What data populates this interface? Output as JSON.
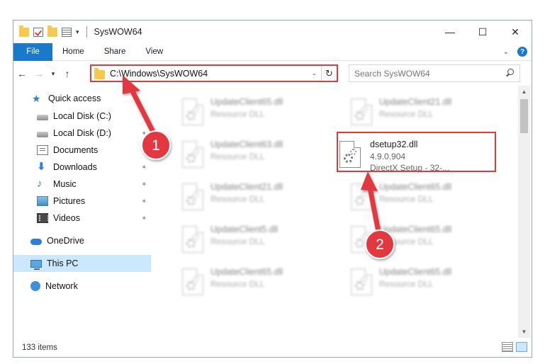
{
  "window": {
    "title": "SysWOW64"
  },
  "ribbon": {
    "tabs": [
      "File",
      "Home",
      "Share",
      "View"
    ]
  },
  "address": {
    "path": "C:\\Windows\\SysWOW64"
  },
  "search": {
    "placeholder": "Search SysWOW64"
  },
  "sidebar": {
    "items": [
      {
        "label": "Quick access",
        "icon": "star-icon"
      },
      {
        "label": "Local Disk (C:)",
        "icon": "drive-icon"
      },
      {
        "label": "Local Disk (D:)",
        "icon": "drive-icon"
      },
      {
        "label": "Documents",
        "icon": "documents-icon"
      },
      {
        "label": "Downloads",
        "icon": "downloads-icon"
      },
      {
        "label": "Music",
        "icon": "music-icon"
      },
      {
        "label": "Pictures",
        "icon": "pictures-icon"
      },
      {
        "label": "Videos",
        "icon": "videos-icon"
      },
      {
        "label": "OneDrive",
        "icon": "onedrive-icon"
      },
      {
        "label": "This PC",
        "icon": "computer-icon"
      },
      {
        "label": "Network",
        "icon": "network-icon"
      }
    ]
  },
  "files": {
    "tiles": [
      {
        "name": "UpdateClient65.dll",
        "sub1": "Resource DLL",
        "sub2": ""
      },
      {
        "name": "UpdateClient21.dll",
        "sub1": "Resource DLL",
        "sub2": ""
      },
      {
        "name": "UpdateClient63.dll",
        "sub1": "Resource DLL",
        "sub2": ""
      },
      {
        "name": "dsetup32.dll",
        "sub1": "4.9.0.904",
        "sub2": "DirectX Setup - 32-..."
      },
      {
        "name": "UpdateClient21.dll",
        "sub1": "Resource DLL",
        "sub2": ""
      },
      {
        "name": "UpdateClient65.dll",
        "sub1": "Resource DLL",
        "sub2": ""
      },
      {
        "name": "UpdateClient5.dll",
        "sub1": "Resource DLL",
        "sub2": ""
      },
      {
        "name": "UpdateClient65.dll",
        "sub1": "Resource DLL",
        "sub2": ""
      },
      {
        "name": "UpdateClient65.dll",
        "sub1": "Resource DLL",
        "sub2": ""
      },
      {
        "name": "UpdateClient65.dll",
        "sub1": "Resource DLL",
        "sub2": ""
      }
    ]
  },
  "status": {
    "item_count": "133 items"
  },
  "annotations": {
    "step1": "1",
    "step2": "2"
  },
  "colors": {
    "accent": "#1979ca",
    "highlight": "#e2393f",
    "selected": "#cce8ff"
  }
}
